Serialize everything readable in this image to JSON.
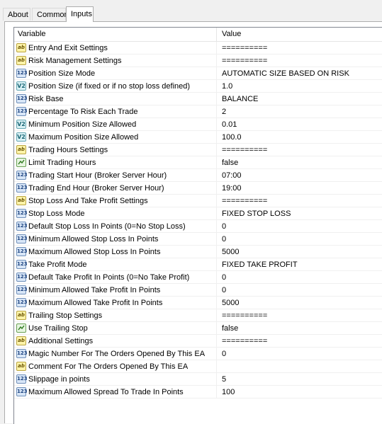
{
  "tabs": [
    {
      "label": "About",
      "active": false
    },
    {
      "label": "Common",
      "active": false
    },
    {
      "label": "Inputs",
      "active": true
    }
  ],
  "grid": {
    "header_variable": "Variable",
    "header_value": "Value",
    "rows": [
      {
        "type": "ab",
        "variable": "Entry And Exit Settings",
        "value": "=========="
      },
      {
        "type": "ab",
        "variable": "Risk Management Settings",
        "value": "=========="
      },
      {
        "type": "n123",
        "variable": "Position Size Mode",
        "value": "AUTOMATIC SIZE BASED ON RISK"
      },
      {
        "type": "v2",
        "variable": "Position Size (if fixed or if no stop loss defined)",
        "value": "1.0"
      },
      {
        "type": "n123",
        "variable": "Risk Base",
        "value": "BALANCE"
      },
      {
        "type": "n123",
        "variable": "Percentage To Risk Each Trade",
        "value": "2"
      },
      {
        "type": "v2",
        "variable": "Minimum Position Size Allowed",
        "value": "0.01"
      },
      {
        "type": "v2",
        "variable": "Maximum Position Size Allowed",
        "value": "100.0"
      },
      {
        "type": "ab",
        "variable": "Trading Hours Settings",
        "value": "=========="
      },
      {
        "type": "bool",
        "variable": "Limit Trading Hours",
        "value": "false"
      },
      {
        "type": "n123",
        "variable": "Trading Start Hour (Broker Server Hour)",
        "value": "07:00"
      },
      {
        "type": "n123",
        "variable": "Trading End Hour (Broker Server Hour)",
        "value": "19:00"
      },
      {
        "type": "ab",
        "variable": "Stop Loss And Take Profit Settings",
        "value": "=========="
      },
      {
        "type": "n123",
        "variable": "Stop Loss Mode",
        "value": "FIXED STOP LOSS"
      },
      {
        "type": "n123",
        "variable": "Default Stop Loss In Points (0=No Stop Loss)",
        "value": "0"
      },
      {
        "type": "n123",
        "variable": "Minimum Allowed Stop Loss In Points",
        "value": "0"
      },
      {
        "type": "n123",
        "variable": "Maximum Allowed Stop Loss In Points",
        "value": "5000"
      },
      {
        "type": "n123",
        "variable": "Take Profit Mode",
        "value": "FIXED TAKE PROFIT"
      },
      {
        "type": "n123",
        "variable": "Default Take Profit In Points (0=No Take Profit)",
        "value": "0"
      },
      {
        "type": "n123",
        "variable": "Minimum Allowed Take Profit In Points",
        "value": "0"
      },
      {
        "type": "n123",
        "variable": "Maximum Allowed Take Profit In Points",
        "value": "5000"
      },
      {
        "type": "ab",
        "variable": "Trailing Stop Settings",
        "value": "=========="
      },
      {
        "type": "bool",
        "variable": "Use Trailing Stop",
        "value": "false"
      },
      {
        "type": "ab",
        "variable": "Additional Settings",
        "value": "=========="
      },
      {
        "type": "n123",
        "variable": "Magic Number For The Orders Opened By This EA",
        "value": "0"
      },
      {
        "type": "ab",
        "variable": "Comment For The Orders Opened By This EA",
        "value": ""
      },
      {
        "type": "n123",
        "variable": "Slippage in points",
        "value": "5"
      },
      {
        "type": "n123",
        "variable": "Maximum Allowed Spread To Trade In Points",
        "value": "100"
      }
    ]
  },
  "icon_names": {
    "ab": "string-type-icon",
    "n123": "integer-type-icon",
    "v2": "double-type-icon",
    "bool": "bool-type-icon"
  },
  "icon_glyphs": {
    "ab": "ab",
    "n123": "123",
    "v2": "V2"
  }
}
